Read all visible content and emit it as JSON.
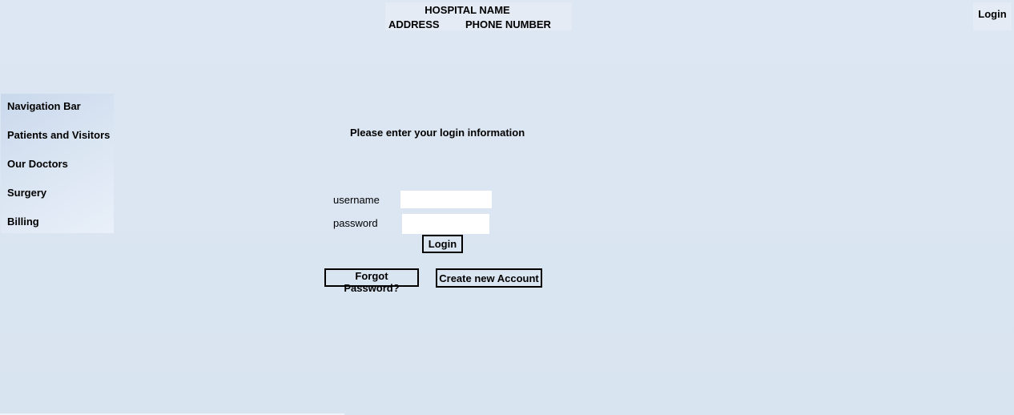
{
  "header": {
    "hospital_name": "HOSPITAL NAME",
    "address": "ADDRESS",
    "phone": "PHONE NUMBER",
    "login_link": "Login"
  },
  "sidebar": {
    "items": [
      {
        "label": "Navigation Bar"
      },
      {
        "label": "Patients and Visitors"
      },
      {
        "label": "Our Doctors"
      },
      {
        "label": "Surgery"
      },
      {
        "label": "Billing"
      }
    ]
  },
  "login_form": {
    "prompt": "Please enter your login information",
    "username_label": "username",
    "password_label": "password",
    "username_value": "",
    "password_value": "",
    "login_button": "Login",
    "forgot_password": "Forgot Password?",
    "create_account": "Create new Account"
  }
}
